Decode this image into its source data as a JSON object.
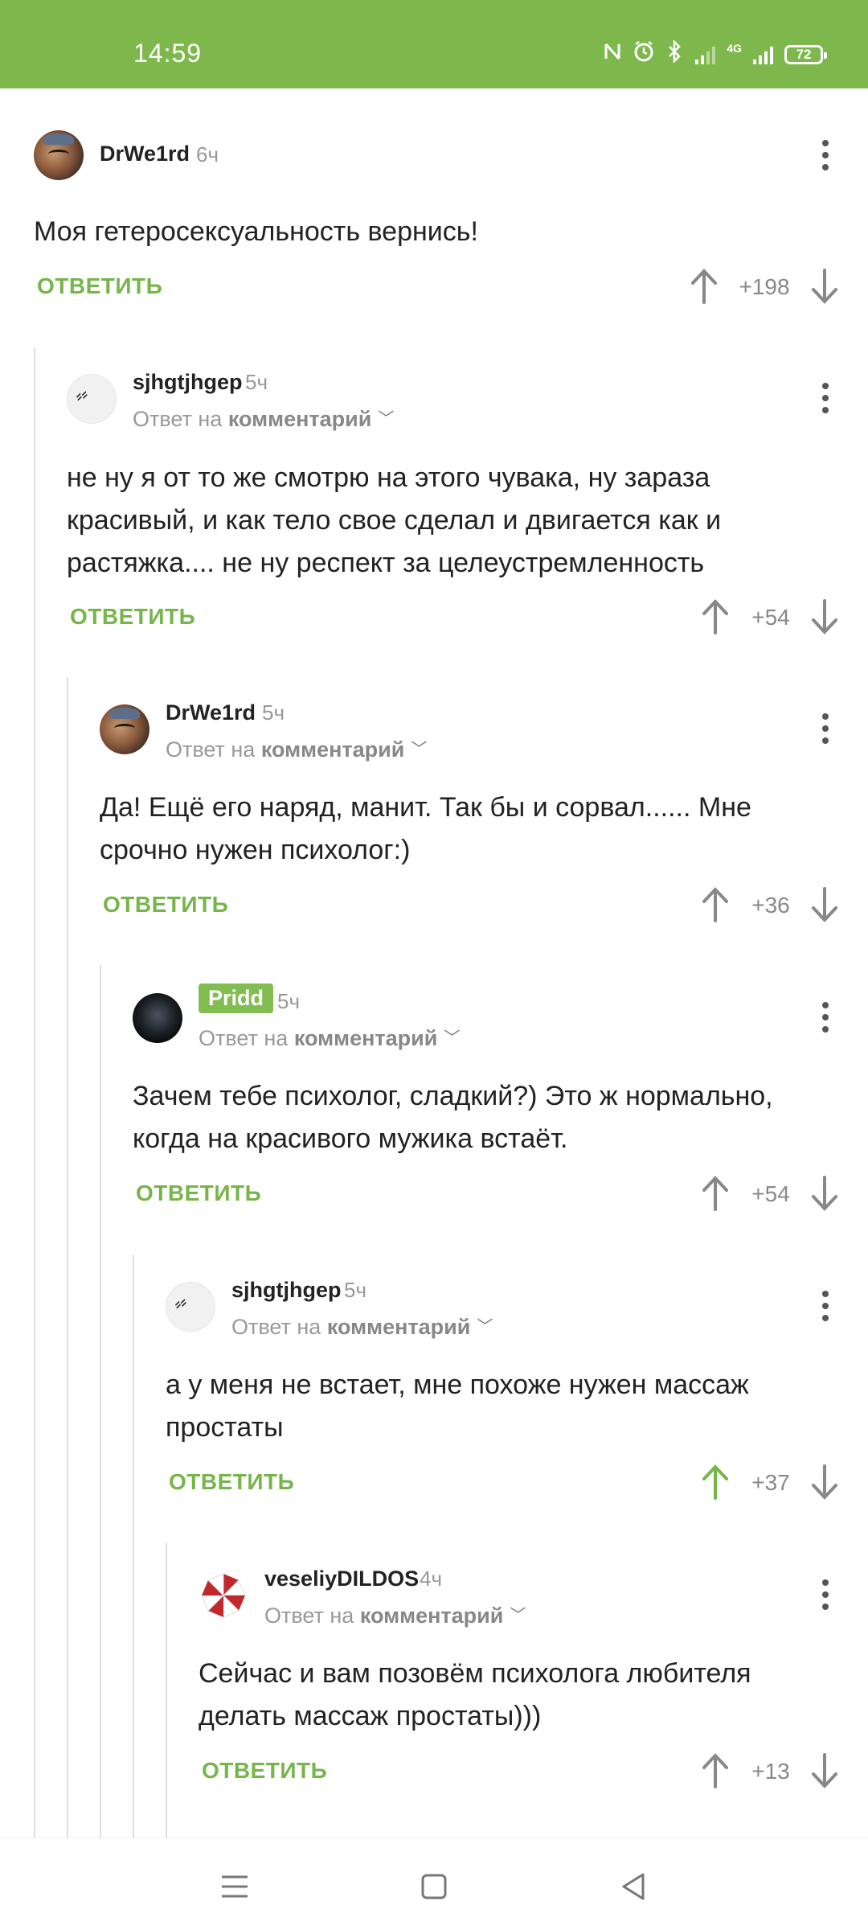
{
  "status_bar": {
    "time": "14:59",
    "icons": [
      "nfc-icon",
      "alarm-icon",
      "bluetooth-icon",
      "signal-icon",
      "4g-signal-icon",
      "battery-icon"
    ],
    "network_label": "4G",
    "battery_level": "72"
  },
  "colors": {
    "status_bar": "#7eb84d",
    "accent_green": "#76b54a",
    "badge_green": "#82bd52",
    "thread_line": "#dedede"
  },
  "comments": [
    {
      "author": "DrWe1rd",
      "time": "6ч",
      "reply_to_prefix": "",
      "reply_to_target": "",
      "text": "Моя гетеросексуальность вернись!",
      "reply_label": "ОТВЕТИТЬ",
      "score": "+198",
      "upvoted": false
    },
    {
      "author": "sjhgtjhgep",
      "time": "5ч",
      "reply_to_prefix": "Ответ на",
      "reply_to_target": "комментарий",
      "text": "не ну я от то же смотрю на этого чувака, ну зараза красивый, и как тело свое сделал и двигается как и растяжка.... не ну респект за целеустремленность",
      "reply_label": "ОТВЕТИТЬ",
      "score": "+54",
      "upvoted": false
    },
    {
      "author": "DrWe1rd",
      "time": "5ч",
      "reply_to_prefix": "Ответ на",
      "reply_to_target": "комментарий",
      "text": "Да! Ещё его наряд, манит. Так бы и сорвал...... Мне срочно нужен психолог:)",
      "reply_label": "ОТВЕТИТЬ",
      "score": "+36",
      "upvoted": false
    },
    {
      "author": "Pridd",
      "time": "5ч",
      "reply_to_prefix": "Ответ на",
      "reply_to_target": "комментарий",
      "text": "Зачем тебе психолог,  сладкий?) Это ж нормально, когда на красивого мужика встаёт.",
      "reply_label": "ОТВЕТИТЬ",
      "score": "+54",
      "upvoted": false
    },
    {
      "author": "sjhgtjhgep",
      "time": "5ч",
      "reply_to_prefix": "Ответ на",
      "reply_to_target": "комментарий",
      "text": "а у меня не встает, мне похоже нужен массаж простаты",
      "reply_label": "ОТВЕТИТЬ",
      "score": "+37",
      "upvoted": true
    },
    {
      "author": "veseliyDILDOS",
      "time": "4ч",
      "reply_to_prefix": "Ответ на",
      "reply_to_target": "комментарий",
      "text": "Сейчас и вам позовём психолога любителя делать массаж простаты)))",
      "reply_label": "ОТВЕТИТЬ",
      "score": "+13",
      "upvoted": false
    }
  ],
  "nav_bar": {
    "buttons": [
      "menu-icon",
      "home-icon",
      "back-icon"
    ]
  }
}
